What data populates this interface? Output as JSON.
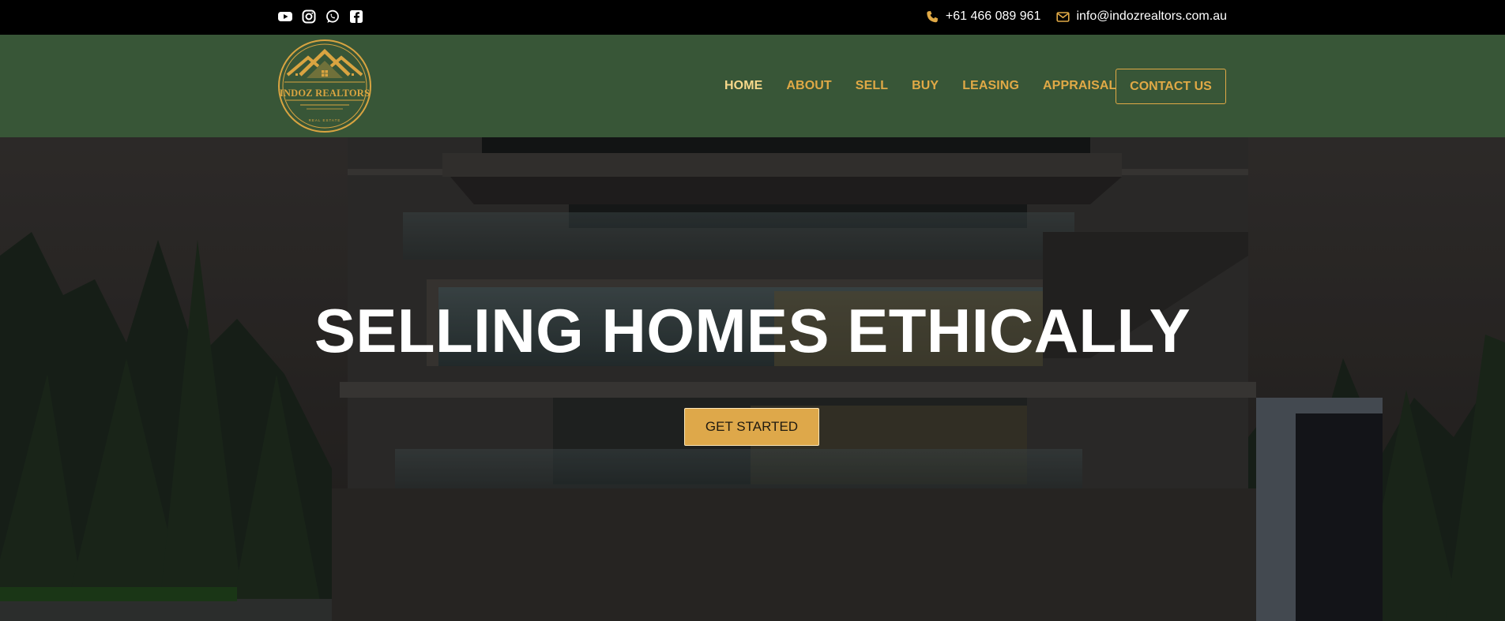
{
  "topbar": {
    "social": [
      "youtube-icon",
      "instagram-icon",
      "whatsapp-icon",
      "facebook-icon"
    ],
    "phone": "+61 466 089 961",
    "email": "info@indozrealtors.com.au",
    "accent": "#e0a946"
  },
  "header": {
    "logo_text": "INDOZ REALTORS",
    "logo_subtext": "REAL ESTATE",
    "nav": [
      "HOME",
      "ABOUT",
      "SELL",
      "BUY",
      "LEASING",
      "APPRAISAL"
    ],
    "active_nav": "HOME",
    "contact_button": "CONTACT US",
    "bg_color": "#385637"
  },
  "hero": {
    "title": "SELLING HOMES ETHICALLY",
    "cta": "GET STARTED",
    "cta_color": "#dea84a"
  }
}
